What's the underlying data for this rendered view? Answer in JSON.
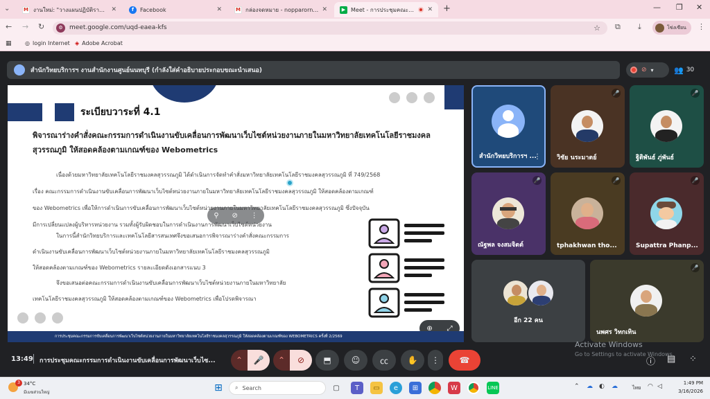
{
  "browser": {
    "tabs": [
      {
        "label": "งานใหม่: \"วางแผนปฏิบัติราชการ 16-",
        "favicon": "mail"
      },
      {
        "label": "Facebook",
        "favicon": "facebook"
      },
      {
        "label": "กล่องจดหมาย - nopparorn.w@rmutsb",
        "favicon": "mail"
      },
      {
        "label": "Meet - การประชุมคณะกรรมการ",
        "favicon": "meet"
      }
    ],
    "url": "meet.google.com/uqd-eaea-kfs",
    "bookmarks": [
      "login Internet",
      "Adobe Acrobat"
    ],
    "profile": "โซ่งเซียน"
  },
  "meet": {
    "presenter_banner": "สำนักวิทยบริการฯ งานสำนักงานศูนย์นนทบุรี (กำลังใส่คำอธิบายประกอบขณะนำเสนอ)",
    "participant_count": "30",
    "clock": "13:49",
    "meeting_title": "การประชุมคณะกรรมการดำเนินงานขับเคลื่อนการพัฒนาเว็บไซ...",
    "slide": {
      "agenda": "ระเบียบวาระที่ 4.1",
      "heading": "พิจารณาร่างคำสั่งคณะกรรมการดำเนินงานขับเคลื่อนการพัฒนาเว็บไซต์หน่วยงานภายในมหาวิทยาลัยเทคโนโลยีราชมงคลสุวรรณภูมิ ให้สอดคล้องตามเกณฑ์ของ Webometrics",
      "p1_lines": [
        "เนื่องด้วยมหาวิทยาลัยเทคโนโลยีราชมงคลสุวรรณภูมิ ได้ดำเนินการจัดทำคำสั่งมหาวิทยาลัยเทคโนโลยีราชมงคลสุวรรณภูมิ ที่ 749/2568",
        "เรื่อง คณะกรรมการดำเนินงานขับเคลื่อนการพัฒนาเว็บไซต์หน่วยงานภายในมหาวิทยาลัยเทคโนโลยีราชมงคลสุวรรณภูมิ ให้สอดคล้องตามเกณฑ์",
        "ของ Webometrics เพื่อให้การดำเนินการขับเคลื่อนการพัฒนาเว็บไซต์หน่วยงานภายในมหาวิทยาลัยเทคโนโลยีราชมงคลสุวรรณภูมิ ซึ่งปัจจุบัน",
        "มีการเปลี่ยนแปลงผู้บริหารหน่วยงาน รวมทั้งผู้รับผิดชอบในการดำเนินงานการพัฒนาเว็บไซต์หน่วยงาน"
      ],
      "p2_lines": [
        "ในการนี้สำนักวิทยบริการและเทคโนโลยีสารสนเทศจึงขอเสนอการพิจารณาร่างคำสั่งคณะกรรมการ",
        "ดำเนินงานขับเคลื่อนการพัฒนาเว็บไซต์หน่วยงานภายในมหาวิทยาลัยเทคโนโลยีราชมงคลสุวรรณภูมิ",
        "ให้สอดคล้องตามเกณฑ์ของ Webometrics รายละเอียดดังเอกสารแนบ 3"
      ],
      "p3_lines": [
        "จึงขอเสนอต่อคณะกรรมการดำเนินงานขับเคลื่อนการพัฒนาเว็บไซต์หน่วยงานภายในมหาวิทยาลัย",
        "เทคโนโลยีราชมงคลสุวรรณภูมิ ให้สอดคล้องตามเกณฑ์ของ Webometrics เพื่อโปรดพิจารณา"
      ],
      "footer": "การประชุมคณะกรรมการขับเคลื่อนการพัฒนาเว็บไซต์หน่วยงานภายในมหาวิทยาลัยเทคโนโลยีราชมงคลสุวรรณภูมิ ให้สอดคล้องตามเกณฑ์ของ WEBOMETRICS ครั้งที่ 2/2569"
    },
    "participants": [
      {
        "name": "สำนักวิทยบริการฯ ...",
        "tile_color": "#1f4a7a",
        "muted": false
      },
      {
        "name": "วิชัย นระมาตย์",
        "tile_color": "#4a3324",
        "muted": true
      },
      {
        "name": "ฐิติพันธ์ ภู่พันธ์",
        "tile_color": "#1e4f45",
        "muted": true
      },
      {
        "name": "ณัฐพล จงสมจิตต์",
        "tile_color": "#4a3268",
        "muted": true
      },
      {
        "name": "tphakhwan tho...",
        "tile_color": "#4a3b22",
        "muted": true
      },
      {
        "name": "Supattra Phanp...",
        "tile_color": "#4a2a2c",
        "muted": true
      },
      {
        "name": "อีก 22 คน",
        "tile_color": "#3c4043",
        "muted": false
      },
      {
        "name": "นพศร วิทกเทิน",
        "tile_color": "#3b3a2c",
        "muted": true
      }
    ],
    "activation": {
      "title": "Activate Windows",
      "subtitle": "Go to Settings to activate Windows."
    }
  },
  "taskbar": {
    "weather_temp": "34°C",
    "weather_text": "มีเมฆส่วนใหญ่",
    "search_placeholder": "Search",
    "lang": "ไทย",
    "time": "1:49 PM",
    "date": "3/16/2026",
    "badge": "3"
  },
  "colors": {
    "accent": "#1f3b73",
    "meet_bg": "#202124",
    "hangup": "#ea4335",
    "tab_bg": "#f6dbe3"
  }
}
